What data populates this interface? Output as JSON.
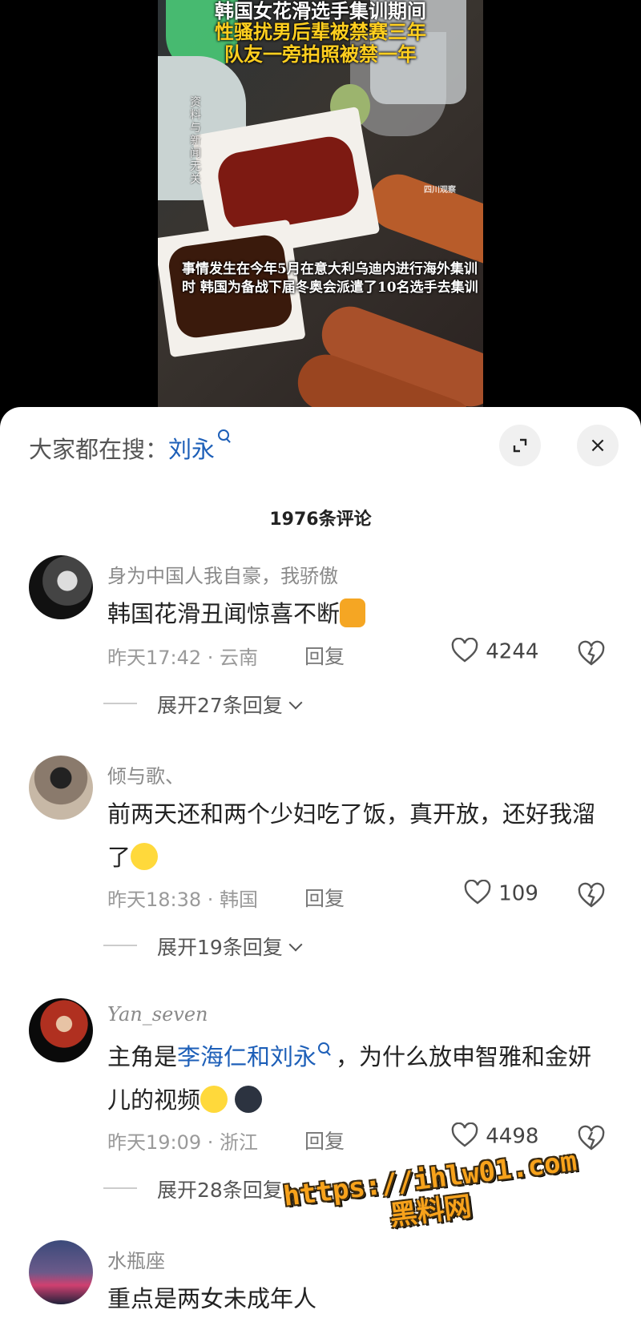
{
  "video": {
    "caption_line1": "韩国女花滑选手集训期间",
    "caption_line2": "性骚扰男后辈被禁赛三年",
    "caption_line3": "队友一旁拍照被禁一年",
    "source_label": "资料与新闻无关",
    "logo": "四川观察",
    "subtitle": "事情发生在今年5月在意大利乌迪内进行海外集训时 韩国为备战下届冬奥会派遣了10名选手去集训"
  },
  "sheet": {
    "search_prefix": "大家都在搜：",
    "search_term": "刘永",
    "expand_icon": "expand-icon",
    "close_icon": "×",
    "comment_count": "1976条评论"
  },
  "comments": [
    {
      "username": "身为中国人我自豪，我骄傲",
      "text": "韩国花滑丑闻惊喜不断",
      "time_location": "昨天17:42 · 云南",
      "reply": "回复",
      "likes": "4244",
      "expand": "展开27条回复"
    },
    {
      "username": "倾与歌、",
      "text": "前两天还和两个少妇吃了饭，真开放，还好我溜了",
      "time_location": "昨天18:38 · 韩国",
      "reply": "回复",
      "likes": "109",
      "expand": "展开19条回复"
    },
    {
      "username": "Yan_seven",
      "text_prefix": "主角是",
      "text_link": "李海仁和刘永",
      "text_suffix": "，为什么放申智雅和金妍儿的视频",
      "time_location": "昨天19:09 · 浙江",
      "reply": "回复",
      "likes": "4498",
      "expand": "展开28条回复"
    },
    {
      "username": "水瓶座",
      "text": "重点是两女未成年人"
    }
  ],
  "watermark": {
    "url": "https://ihlw01.com",
    "name": "黑料网"
  },
  "colors": {
    "link": "#1d5fb8",
    "watermark": "#f7a21b"
  }
}
